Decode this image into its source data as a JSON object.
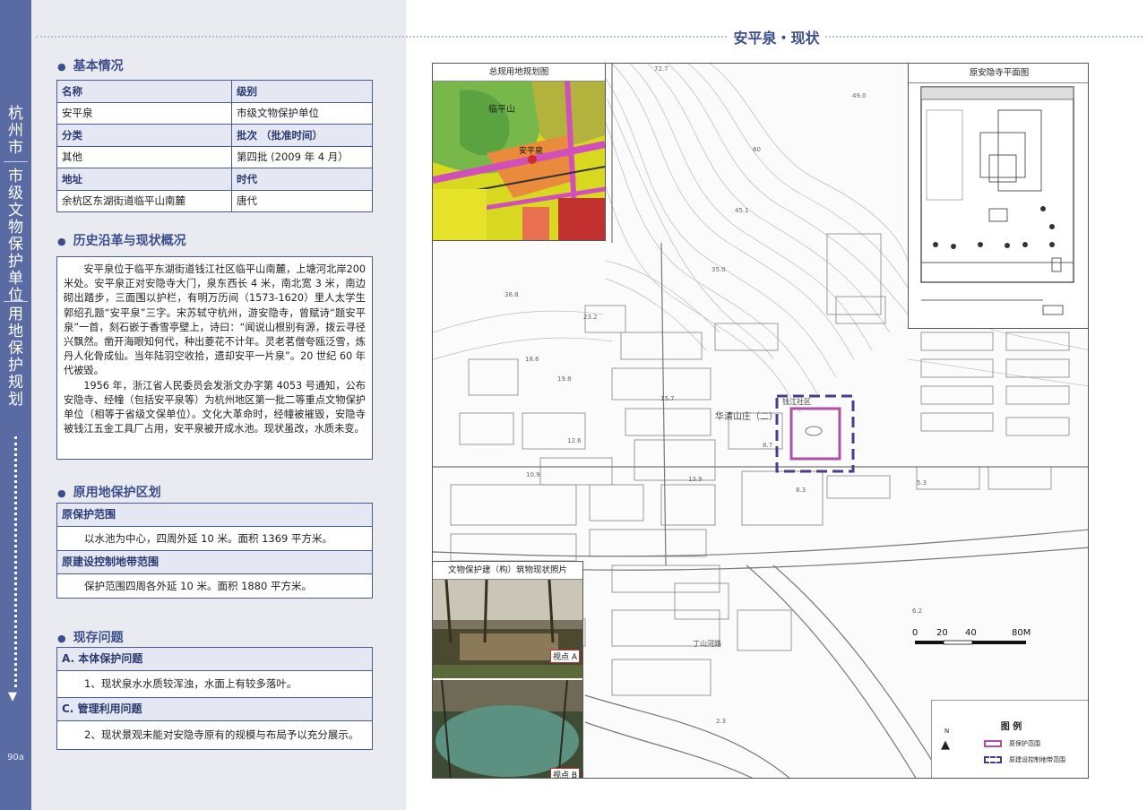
{
  "sidebar": {
    "city": "杭州市",
    "level": "市级文物保护单位",
    "plan": "用地保护规划",
    "page_number": "90a"
  },
  "header": {
    "title": "安平泉・现状"
  },
  "basic_info": {
    "heading": "基本情况",
    "rows": [
      [
        "名称",
        "级别"
      ],
      [
        "安平泉",
        "市级文物保护单位"
      ],
      [
        "分类",
        "批次 （批准时间）"
      ],
      [
        "其他",
        "第四批 (2009 年 4 月）"
      ],
      [
        "地址",
        "时代"
      ],
      [
        "余杭区东湖街道临平山南麓",
        "唐代"
      ]
    ]
  },
  "history": {
    "heading": "历史沿革与现状概况",
    "paragraphs": [
      "安平泉位于临平东湖街道钱江社区临平山南麓，上塘河北岸200 米处。安平泉正对安隐寺大门，泉东西长 4 米，南北宽 3 米，南边砌出踏步，三面围以护栏，有明万历间（1573-1620）里人太学生郭绍孔题“安平泉”三字。宋苏轼守杭州，游安隐寺，曾赋诗“题安平泉”一首，刻石嵌于香雪亭壁上，诗曰：“闻说山根别有源，拨云寻径兴飘然。凿开海眼知何代，种出菱花不计年。灵老茗僧夸瓯泛雪，炼丹人化骨成仙。当年陆羽空收拾，遗却安平一片泉”。20 世纪 60 年代被毁。",
      "1956 年，浙江省人民委员会发浙文办字第 4053 号通知，公布安隐寺、经幢（包括安平泉等）为杭州地区第一批二等重点文物保护单位（相等于省级文保单位）。文化大革命时，经幢被摧毁，安隐寺被钱江五金工具厂占用，安平泉被开成水池。现状虽改，水质未变。"
    ]
  },
  "protection": {
    "heading": "原用地保护区划",
    "range_label": "原保护范围",
    "range_text": "以水池为中心，四周外延 10 米。面积 1369 平方米。",
    "control_label": "原建设控制地带范围",
    "control_text": "保护范围四周各外延 10 米。面积 1880 平方米。"
  },
  "problems": {
    "heading": "现存问题",
    "a_label": "A. 本体保护问题",
    "a_text": "1、现状泉水水质较浑浊，水面上有较多落叶。",
    "c_label": "C. 管理利用问题",
    "c_text": "2、现状景观未能对安隐寺原有的规模与布局予以充分展示。"
  },
  "map": {
    "landuse_title": "总规用地规划图",
    "landuse_mountain": "临平山",
    "landuse_spring": "安平泉",
    "temple_title": "原安隐寺平面图",
    "photo_title": "文物保护建（构）筑物现状照片",
    "photo_a": "视点 A",
    "photo_b": "视点 B",
    "site_label": "华清山庄（二）",
    "community_label": "钱江社区",
    "road1": "丁山河路",
    "scale_ticks": [
      "0",
      "20",
      "40",
      "80M"
    ],
    "legend_title": "图  例",
    "legend_items": [
      "原保护范围",
      "原建设控制地带范围"
    ],
    "legend_colors": [
      "#b04fa6",
      "#4a3d8f"
    ],
    "north": "N",
    "contours": [
      "72.7",
      "49.0",
      "60",
      "45.1",
      "35.0",
      "36.8",
      "23.2",
      "19.8",
      "18.6",
      "15.7",
      "12.6",
      "10.9",
      "13.9",
      "8.3",
      "8.7",
      "6.2",
      "5.3",
      "2.3"
    ]
  }
}
